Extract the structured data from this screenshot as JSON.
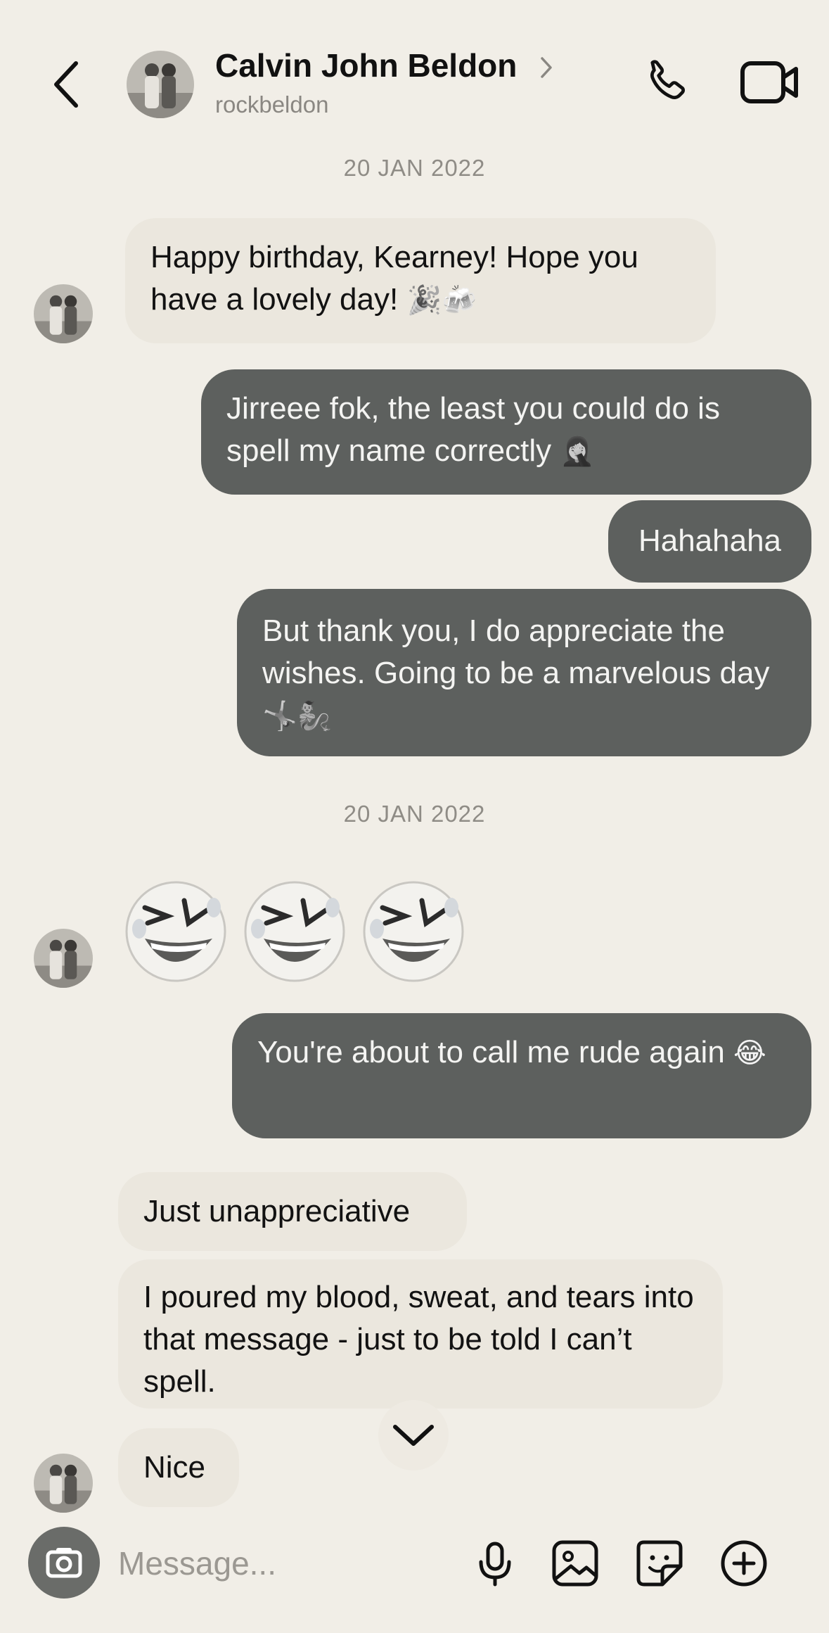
{
  "header": {
    "name": "Calvin John Beldon",
    "handle": "rockbeldon"
  },
  "dates": [
    "20 JAN 2022",
    "20 JAN 2022"
  ],
  "messages": {
    "m1": {
      "text": "Happy birthday, Kearney! Hope you have a lovely day!",
      "emoji": "🎉🍻"
    },
    "m2": {
      "text": "Jirreee fok, the least you could do is spell my name correctly",
      "emoji": "🤦‍♀️"
    },
    "m3": {
      "text": "Hahahaha"
    },
    "m4": {
      "text": "But thank you, I do appreciate the wishes. Going to be a marvelous day",
      "emoji": "🤸🧞"
    },
    "m5": {
      "emoji": "🤣🤣🤣"
    },
    "m6": {
      "text": "You're about to call me rude again",
      "emoji": "😂"
    },
    "m7": {
      "text": "Just unappreciative"
    },
    "m8": {
      "text": "I poured my blood, sweat, and tears into that message - just to be told I can’t spell."
    },
    "m9": {
      "text": "Nice"
    }
  },
  "composer": {
    "placeholder": "Message..."
  },
  "icons": {
    "back": "chevron-left-icon",
    "call": "phone-icon",
    "video": "video-camera-icon",
    "camera": "camera-icon",
    "mic": "microphone-icon",
    "gallery": "image-icon",
    "sticker": "sticker-icon",
    "add": "plus-circle-icon",
    "scroll": "chevron-down-icon"
  },
  "colors": {
    "background": "#f1eee7",
    "incoming_bubble": "#ebe7de",
    "outgoing_bubble": "#5d605e"
  }
}
